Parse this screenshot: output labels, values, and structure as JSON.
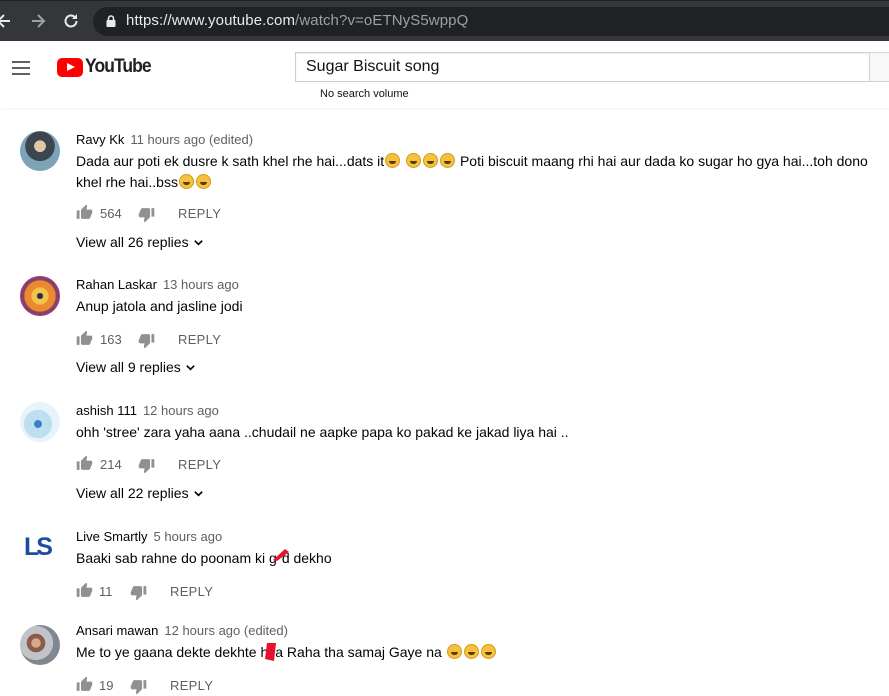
{
  "browser": {
    "url_host": "https://www.youtube.com",
    "url_path": "/watch?v=oETNyS5wppQ"
  },
  "header": {
    "logo_text": "YouTube",
    "search_value": "Sugar Biscuit song",
    "search_hint": "No search volume"
  },
  "comments": [
    {
      "author": "Ravy Kk",
      "time": "11 hours ago (edited)",
      "text_parts": [
        "Dada aur poti ek dusre k sath khel rhe hai...dats it",
        "Poti biscuit maang rhi hai aur dada ko sugar ho gya hai...toh dono",
        "khel rhe hai..bss"
      ],
      "likes": "564",
      "reply": "REPLY",
      "view_replies": "View all 26 replies"
    },
    {
      "author": "Rahan Laskar",
      "time": "13 hours ago",
      "text": "Anup jatola and jasline jodi",
      "likes": "163",
      "reply": "REPLY",
      "view_replies": "View all 9 replies"
    },
    {
      "author": "ashish 111",
      "time": "12 hours ago",
      "text": "ohh 'stree' zara yaha aana ..chudail ne aapke papa ko pakad ke jakad liya hai ..",
      "likes": "214",
      "reply": "REPLY",
      "view_replies": "View all 22 replies"
    },
    {
      "author": "Live Smartly",
      "time": "5 hours ago",
      "text_a": "Baaki sab rahne do poonam ki g",
      "text_b": "d dekho",
      "likes": "11",
      "reply": "REPLY",
      "avatar_text": "LS"
    },
    {
      "author": "Ansari mawan",
      "time": "12 hours ago (edited)",
      "text_a": "Me to ye gaana dekte dekhte h",
      "text_b": "a Raha tha samaj Gaye na",
      "likes": "19",
      "reply": "REPLY"
    }
  ],
  "colors": {
    "brand_red": "#ff0000",
    "chrome_dark": "#35363a",
    "meta_gray": "#606060"
  },
  "icons": [
    "back-arrow-icon",
    "forward-arrow-icon",
    "reload-icon",
    "lock-icon",
    "menu-icon",
    "thumb-up-icon",
    "thumb-down-icon",
    "chevron-down-icon",
    "laughing-emoji-icon"
  ]
}
